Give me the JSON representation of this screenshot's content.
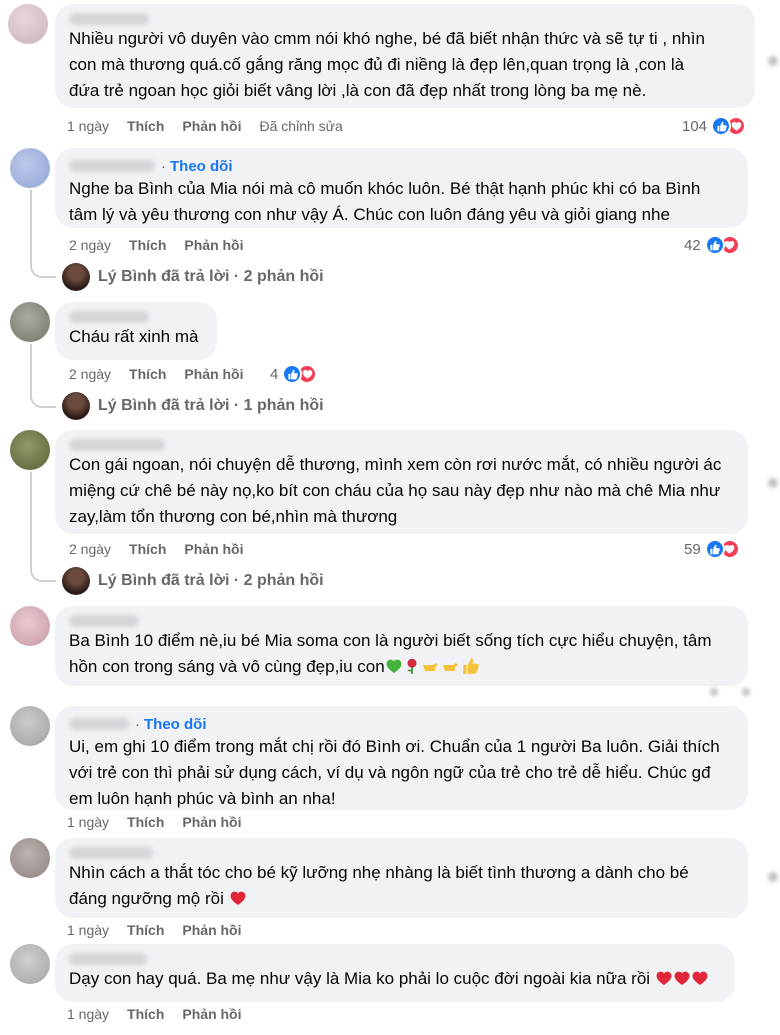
{
  "actions": {
    "like": "Thích",
    "reply": "Phản hồi",
    "edited": "Đã chỉnh sửa",
    "follow": "Theo dõi",
    "dot": "·"
  },
  "comments": [
    {
      "time": "1 ngày",
      "text_lines": [
        "Nhiều người vô duyên vào cmm nói khó nghe, bé đã biết nhận thức và sẽ tự ti , nhìn",
        "con mà thương quá.cố gắng răng mọc đủ đi niềng là đẹp lên,quan trọng là ,con là",
        "đứa trẻ ngoan học giỏi biết vâng lời ,là con đã đẹp nhất trong lòng ba mẹ nè."
      ],
      "reactions": "104"
    },
    {
      "time": "2 ngày",
      "text_lines": [
        "Nghe ba Bình của Mia nói mà cô muốn khóc luôn. Bé thật hạnh phúc khi có ba Bình",
        "tâm lý và yêu thương con như vậy Á. Chúc con luôn đáng yêu và giỏi giang nhe"
      ],
      "reactions": "42",
      "replies": "Lý Bình đã trả lời · 2 phản hồi"
    },
    {
      "time": "2 ngày",
      "text_lines": [
        "Cháu rất xinh mà"
      ],
      "reactions": "4",
      "replies": "Lý Bình đã trả lời · 1 phản hồi"
    },
    {
      "time": "2 ngày",
      "text_lines": [
        "Con gái ngoan, nói chuyện dễ thương, mình xem còn rơi nước mắt, có nhiều người ác",
        "miệng cứ chê bé này nọ,ko bít con cháu của họ sau này đẹp như nào mà chê Mia như",
        "zay,làm tổn thương con bé,nhìn mà thương"
      ],
      "reactions": "59",
      "replies": "Lý Bình đã trả lời · 2 phản hồi"
    },
    {
      "text_lines": [
        "Ba Bình 10 điểm nè,iu bé Mia soma con là người biết sống tích cực hiểu chuyện, tâm",
        "hồn con trong sáng và vô cùng đẹp,iu con"
      ]
    },
    {
      "time": "1 ngày",
      "text_lines": [
        "Ui, em ghi 10 điểm trong mắt chị rồi đó Bình ơi. Chuẩn của 1 người Ba luôn. Giải thích",
        "với trẻ con thì phải sử dụng cách, ví dụ và ngôn ngữ của trẻ cho trẻ dễ hiểu. Chúc gđ",
        "em luôn hạnh phúc và bình an nha!"
      ]
    },
    {
      "time": "1 ngày",
      "text_lines": [
        "Nhìn cách a thắt tóc cho bé kỹ lưỡng nhẹ nhàng là biết tình thương a dành cho bé",
        "đáng ngưỡng mộ rồi"
      ]
    },
    {
      "time": "1 ngày",
      "text_lines": [
        "Dạy con hay quá. Ba mẹ như vậy là Mia ko phải lo cuộc đời ngoài kia nữa rồi"
      ]
    }
  ],
  "colors": {
    "bubble": "#f0f2f5",
    "link": "#1877f2",
    "meta": "#65676b",
    "love": "#f33e58",
    "like": "#1877f2"
  }
}
